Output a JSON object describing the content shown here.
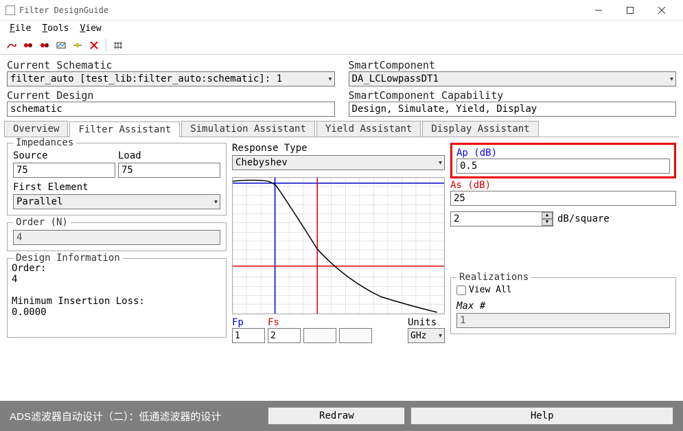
{
  "window": {
    "title": "Filter DesignGuide"
  },
  "menu": {
    "file": "File",
    "tools": "Tools",
    "view": "View"
  },
  "fields": {
    "current_schematic_label": "Current Schematic",
    "current_schematic_value": "filter_auto [test_lib:filter_auto:schematic]: 1",
    "smartcomponent_label": "SmartComponent",
    "smartcomponent_value": "DA_LCLowpassDT1",
    "current_design_label": "Current Design",
    "current_design_value": "schematic",
    "smartcap_label": "SmartComponent Capability",
    "smartcap_value": "Design, Simulate, Yield, Display"
  },
  "tabs": {
    "overview": "Overview",
    "filter": "Filter Assistant",
    "simulation": "Simulation Assistant",
    "yield": "Yield Assistant",
    "display": "Display Assistant"
  },
  "impedances": {
    "group": "Impedances",
    "source_label": "Source",
    "source_value": "75",
    "load_label": "Load",
    "load_value": "75",
    "first_element_label": "First Element",
    "first_element_value": "Parallel"
  },
  "order": {
    "group": "Order (N)",
    "value": "4"
  },
  "design_info": {
    "group": "Design Information",
    "text": "Order:\n4\n\nMinimum Insertion Loss:\n0.0000"
  },
  "response": {
    "type_label": "Response Type",
    "type_value": "Chebyshev",
    "fp_label": "Fp",
    "fp_value": "1",
    "fs_label": "Fs",
    "fs_value": "2",
    "units_label": "Units",
    "units_value": "GHz"
  },
  "params": {
    "ap_label": "Ap (dB)",
    "ap_value": "0.5",
    "as_label": "As (dB)",
    "as_value": "25",
    "db_square_value": "2",
    "db_square_unit": "dB/square"
  },
  "realizations": {
    "group": "Realizations",
    "view_all": "View All",
    "max_label": "Max #",
    "max_value": "1"
  },
  "buttons": {
    "redraw": "Redraw",
    "help": "Help"
  },
  "caption": "ADS滤波器自动设计（二）：低通滤波器的设计"
}
